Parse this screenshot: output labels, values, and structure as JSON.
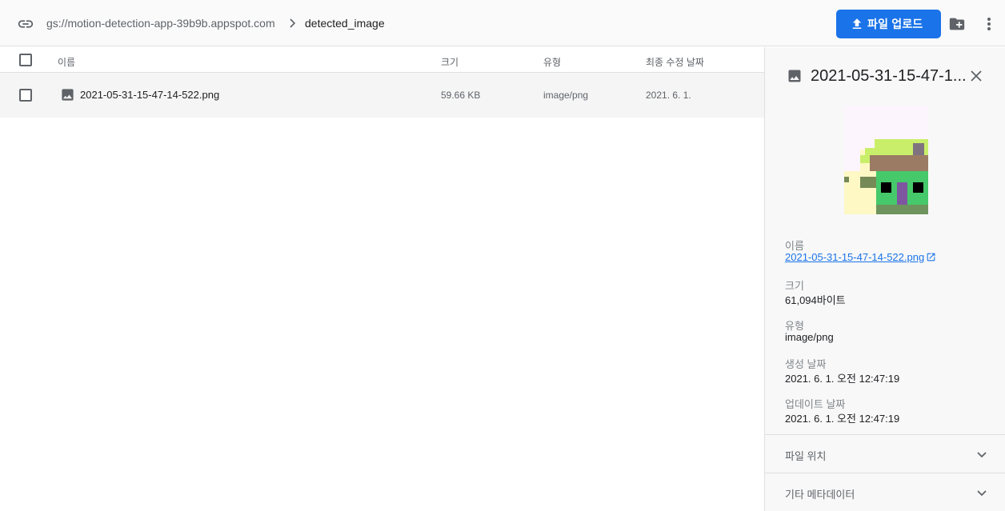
{
  "toolbar": {
    "bucket_path": "gs://motion-detection-app-39b9b.appspot.com",
    "current_folder": "detected_image",
    "upload_label": "파일 업로드",
    "icons": {
      "link": "link-icon",
      "breadcrumb": "chevron-right-icon",
      "upload": "upload-icon",
      "new_folder": "create-folder-icon",
      "more": "more-vert-icon"
    },
    "accent_color": "#1a73e8"
  },
  "table": {
    "columns": {
      "name": "이름",
      "size": "크기",
      "type": "유형",
      "modified": "최종 수정 날짜"
    },
    "rows": [
      {
        "name": "2021-05-31-15-47-14-522.png",
        "size": "59.66 KB",
        "type": "image/png",
        "modified": "2021. 6. 1.",
        "icon": "image-icon"
      }
    ]
  },
  "details": {
    "title": "2021-05-31-15-47-1...",
    "name_label": "이름",
    "name_value": "2021-05-31-15-47-14-522.png",
    "size_label": "크기",
    "size_value": "61,094바이트",
    "type_label": "유형",
    "type_value": "image/png",
    "created_label": "생성 날짜",
    "created_value": "2021. 6. 1. 오전 12:47:19",
    "updated_label": "업데이트 날짜",
    "updated_value": "2021. 6. 1. 오전 12:47:19",
    "sections": [
      {
        "label": "파일 위치"
      },
      {
        "label": "기타 메타데이터"
      }
    ]
  }
}
